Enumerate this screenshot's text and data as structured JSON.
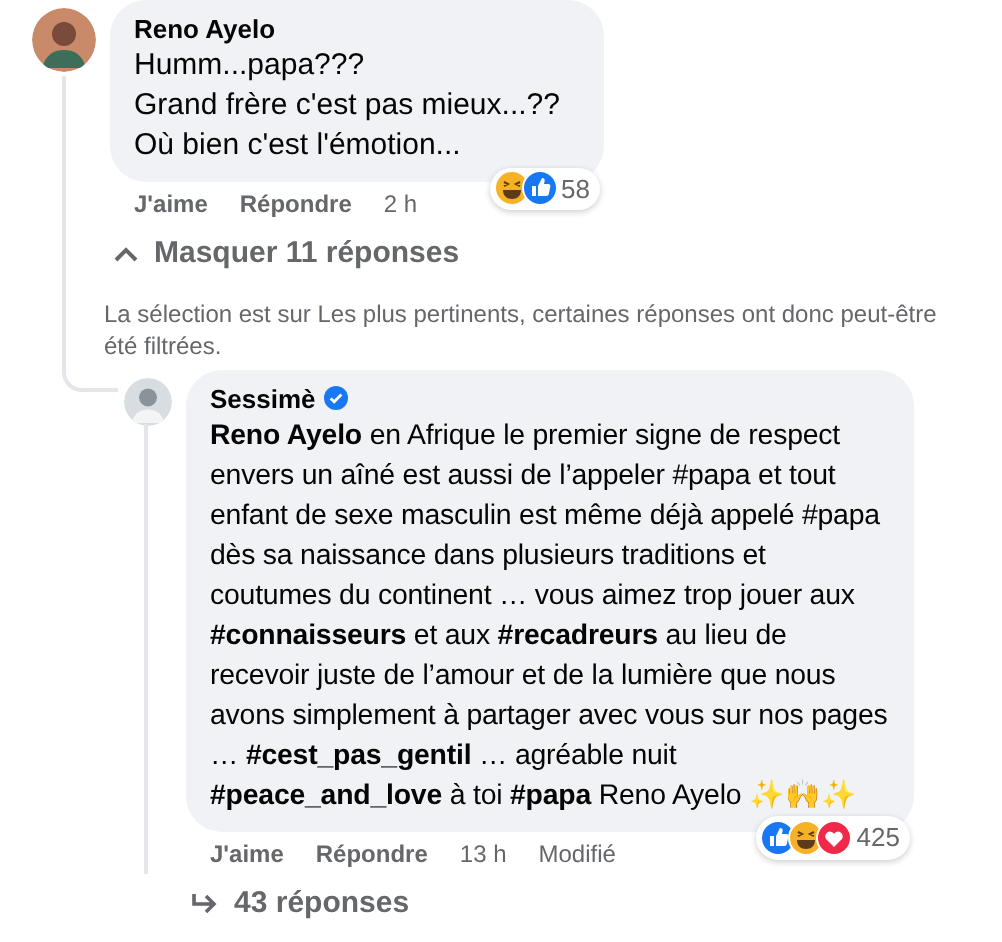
{
  "comments": [
    {
      "author": "Reno Ayelo",
      "verified": false,
      "lines": [
        "Humm...papa???",
        "Grand frère c'est pas mieux...??",
        "Où bien c'est l'émotion..."
      ],
      "reactions": {
        "icons": [
          {
            "kind": "haha"
          },
          {
            "kind": "like"
          }
        ],
        "count": "58"
      },
      "actions": [
        "J'aime",
        "Répondre"
      ],
      "time": "2 h",
      "replies_toggle": {
        "label": "Masquer 11 réponses"
      },
      "notice": "La sélection est sur Les plus pertinents, certaines réponses ont donc peut-être été filtrées."
    },
    {
      "author": "Sessimè",
      "verified": true,
      "lines": [
        "**Reno Ayelo** en Afrique le premier signe de respect envers un aîné est aussi de l’appeler #papa et tout enfant de sexe masculin est même déjà appelé #papa dès sa naissance dans plusieurs traditions et coutumes du continent … vous aimez trop jouer aux **#connaisseurs** et aux **#recadreurs** au lieu de recevoir juste de l’amour et de la lumière que nous avons simplement à partager avec vous sur nos pages … **#cest_pas_gentil** … agréable nuit **#peace_and_love** à toi **#papa** Reno Ayelo ✨🙌✨"
      ],
      "reactions": {
        "icons": [
          {
            "kind": "like"
          },
          {
            "kind": "haha"
          },
          {
            "kind": "love"
          }
        ],
        "count": "425"
      },
      "actions": [
        "J'aime",
        "Répondre"
      ],
      "time": "13 h",
      "edited": "Modifié",
      "replies_toggle": {
        "label": "43 réponses"
      }
    }
  ]
}
